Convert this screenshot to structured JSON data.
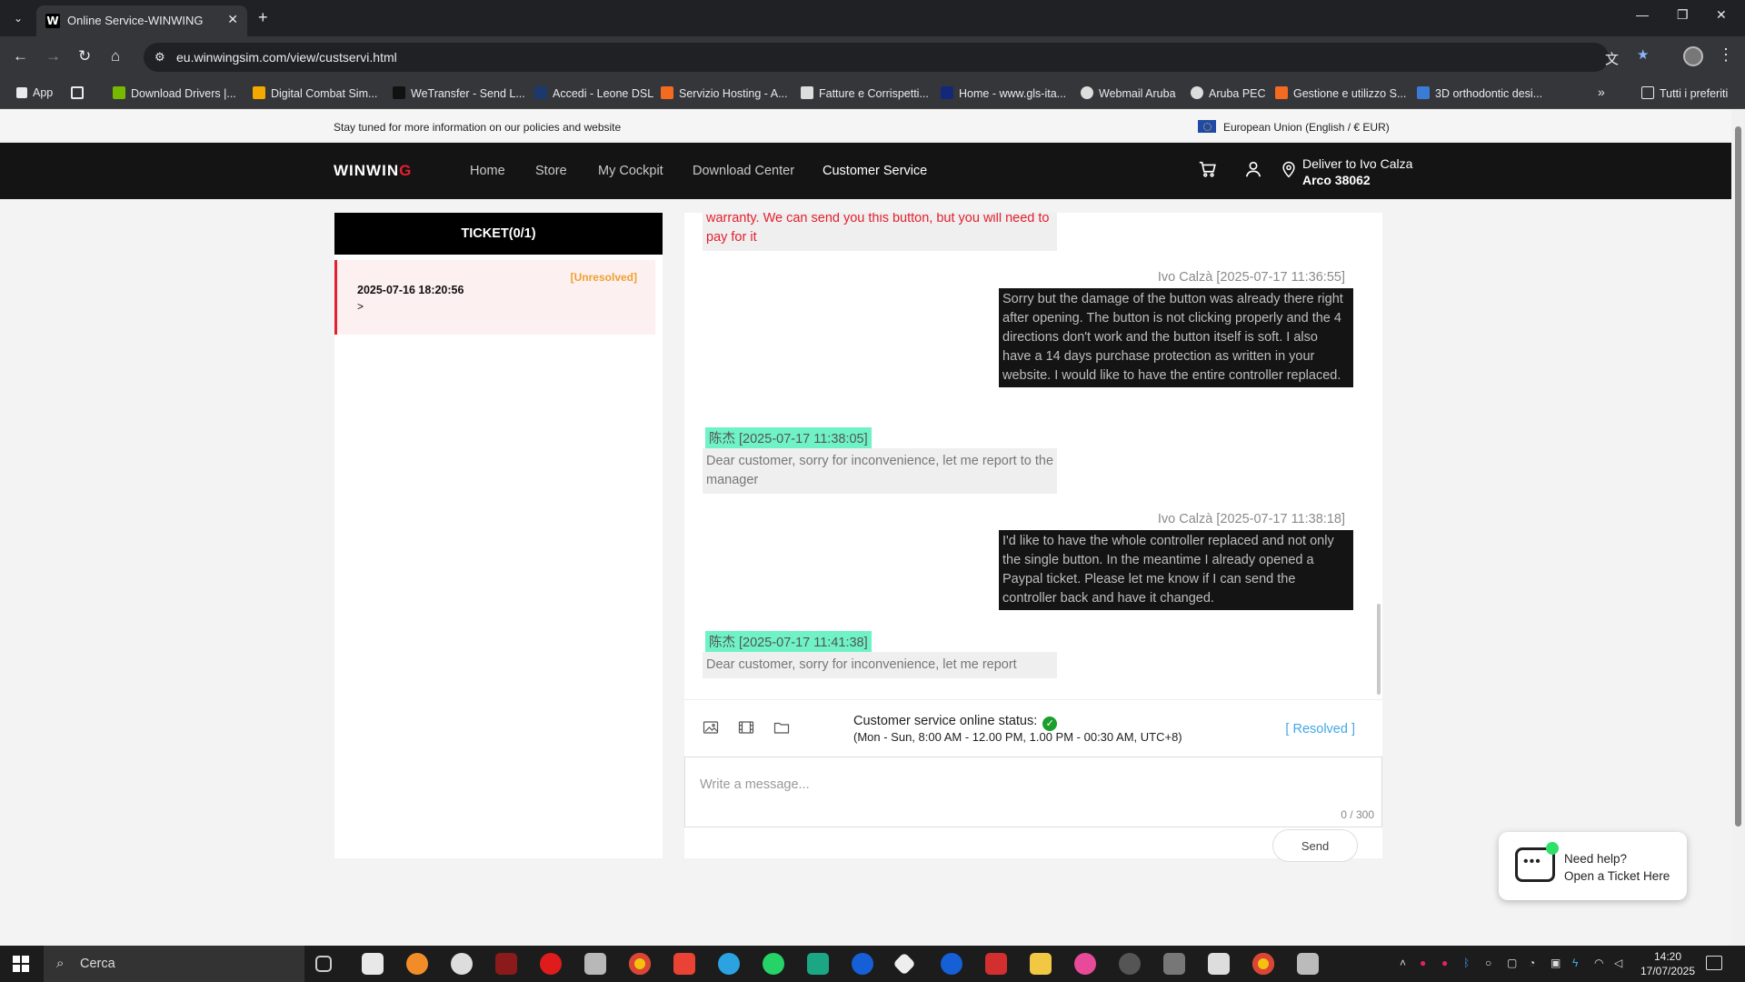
{
  "browser": {
    "tab_title": "Online Service-WINWING",
    "tab_favicon": "W",
    "url": "eu.winwingsim.com/view/custservi.html",
    "bookmarks": [
      "App",
      "Download Drivers |...",
      "Digital Combat Sim...",
      "WeTransfer - Send L...",
      "Accedi - Leone DSL",
      "Servizio Hosting - A...",
      "Fatture e Corrispetti...",
      "Home - www.gls-ita...",
      "Webmail Aruba",
      "Aruba PEC",
      "Gestione e utilizzo S...",
      "3D orthodontic desi..."
    ],
    "all_bookmarks": "Tutti i preferiti"
  },
  "announcement": {
    "text": "Stay tuned for more information on our policies and website",
    "region": "European Union (English / € EUR)"
  },
  "header": {
    "logo_main": "WINWIN",
    "logo_accent": "G",
    "nav": [
      "Home",
      "Store",
      "My Cockpit",
      "Download Center",
      "Customer Service"
    ],
    "active_nav": "Customer Service",
    "deliver_line1": "Deliver to Ivo Calza",
    "deliver_line2": "Arco 38062"
  },
  "tickets": {
    "header": "TICKET(0/1)",
    "items": [
      {
        "date": "2025-07-16 18:20:56",
        "arrow": ">",
        "status": "[Unresolved]"
      }
    ]
  },
  "chat": {
    "messages": [
      {
        "side": "left",
        "text": "warranty. We can send you this button, but you will need to pay for it",
        "highlight": "#e4202e"
      },
      {
        "side": "right",
        "meta": "Ivo Calzà [2025-07-17 11:36:55]",
        "text": "Sorry but the damage of the button was already there right after opening. The button is not clicking properly and the 4 directions don't work and the button itself is soft. I also have a 14 days purchase protection as written in your website. I would like to have the entire controller replaced."
      },
      {
        "side": "left",
        "meta": "陈杰 [2025-07-17 11:38:05]",
        "text": "Dear customer, sorry for inconvenience, let me report to the manager"
      },
      {
        "side": "right",
        "meta": "Ivo Calzà [2025-07-17 11:38:18]",
        "text": "I'd like to have the whole controller replaced and not only the single button. In the meantime I already opened a Paypal ticket. Please let me know if I can send the controller back and have it changed."
      },
      {
        "side": "left",
        "meta": "陈杰 [2025-07-17 11:41:38]",
        "text": "Dear customer, sorry for inconvenience, let me report"
      }
    ],
    "status_label": "Customer service online status:",
    "hours": "(Mon - Sun, 8:00 AM - 12.00 PM, 1.00 PM - 00:30 AM, UTC+8)",
    "resolved_link": "[ Resolved ]",
    "placeholder": "Write a message...",
    "counter": "0 / 300",
    "send": "Send"
  },
  "help_widget": {
    "line1": "Need help?",
    "line2": "Open a Ticket Here"
  },
  "taskbar": {
    "search": "Cerca",
    "time": "14:20",
    "date": "17/07/2025"
  },
  "colors": {
    "brand_red": "#e4202e",
    "agent_tag": "#6ef2c6",
    "status_orange": "#f0a030",
    "link_blue": "#41a8e8"
  }
}
